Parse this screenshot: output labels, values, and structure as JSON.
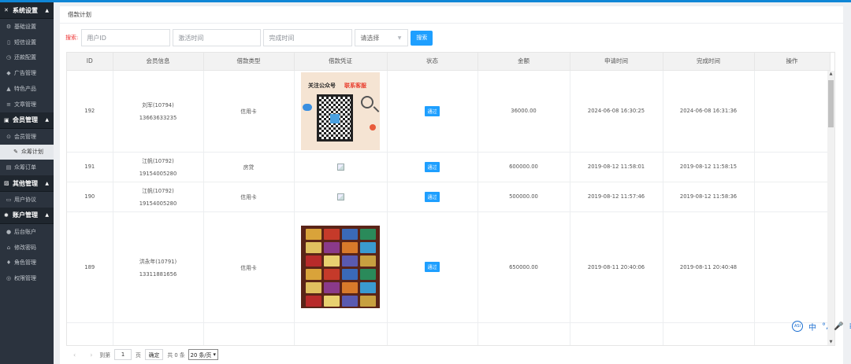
{
  "sidebar": {
    "sections": [
      {
        "title": "系统设置",
        "icon": "tools-icon",
        "glyph": "✕",
        "items": [
          {
            "label": "基础设置",
            "icon": "gear-icon",
            "glyph": "⚙"
          },
          {
            "label": "短信设置",
            "icon": "sms-icon",
            "glyph": "▯"
          },
          {
            "label": "还款配置",
            "icon": "repay-icon",
            "glyph": "◷"
          },
          {
            "label": "广告管理",
            "icon": "ad-icon",
            "glyph": "◆"
          },
          {
            "label": "特色产品",
            "icon": "bell-icon",
            "glyph": "▲"
          },
          {
            "label": "文章管理",
            "icon": "list-icon",
            "glyph": "≡"
          }
        ]
      },
      {
        "title": "会员管理",
        "icon": "member-icon",
        "glyph": "▣",
        "items": [
          {
            "label": "会员管理",
            "icon": "user-icon",
            "glyph": "⊙"
          },
          {
            "label": "众筹计划",
            "icon": "edit-icon",
            "glyph": "✎",
            "active": true
          },
          {
            "label": "众筹订单",
            "icon": "order-icon",
            "glyph": "▤"
          }
        ]
      },
      {
        "title": "其他管理",
        "icon": "other-icon",
        "glyph": "▨",
        "items": [
          {
            "label": "用户协议",
            "icon": "agreement-icon",
            "glyph": "▭"
          }
        ]
      },
      {
        "title": "账户管理",
        "icon": "account-icon",
        "glyph": "✱",
        "items": [
          {
            "label": "后台账户",
            "icon": "admin-icon",
            "glyph": "●"
          },
          {
            "label": "修改密码",
            "icon": "lock-icon",
            "glyph": "⌂"
          },
          {
            "label": "角色管理",
            "icon": "role-icon",
            "glyph": "♦"
          },
          {
            "label": "权限管理",
            "icon": "permission-icon",
            "glyph": "◎"
          }
        ]
      }
    ]
  },
  "page": {
    "title": "借款计划"
  },
  "search": {
    "label": "搜索:",
    "user_id_placeholder": "用户ID",
    "activate_time_placeholder": "激活时间",
    "complete_time_placeholder": "完成时间",
    "select_placeholder": "请选择",
    "button": "搜索"
  },
  "table": {
    "columns": [
      "ID",
      "会员信息",
      "借款类型",
      "借款凭证",
      "状态",
      "金额",
      "申请时间",
      "完成时间",
      "操作"
    ],
    "rows": [
      {
        "id": "192",
        "name": "刘军(10794)",
        "phone": "13663633235",
        "type": "信用卡",
        "voucher": "qr",
        "status": "通过",
        "amount": "36000.00",
        "apply_time": "2024-06-08 16:30:25",
        "done_time": "2024-06-08 16:31:36"
      },
      {
        "id": "191",
        "name": "江帆(10792)",
        "phone": "19154005280",
        "type": "房贷",
        "voucher": "broken",
        "status": "通过",
        "amount": "600000.00",
        "apply_time": "2019-08-12 11:58:01",
        "done_time": "2019-08-12 11:58:15"
      },
      {
        "id": "190",
        "name": "江帆(10792)",
        "phone": "19154005280",
        "type": "信用卡",
        "voucher": "broken",
        "status": "通过",
        "amount": "500000.00",
        "apply_time": "2019-08-12 11:57:46",
        "done_time": "2019-08-12 11:58:36"
      },
      {
        "id": "189",
        "name": "洪永年(10791)",
        "phone": "13311881656",
        "type": "信用卡",
        "voucher": "cards",
        "status": "通过",
        "amount": "650000.00",
        "apply_time": "2019-08-11 20:40:06",
        "done_time": "2019-08-11 20:40:48"
      }
    ],
    "qr_caption_left": "关注公众号",
    "qr_caption_right": "联系客服"
  },
  "pager": {
    "prev": "‹",
    "next": "›",
    "goto_label": "到第",
    "page_value": "1",
    "page_unit": "页",
    "confirm": "确定",
    "total": "共 0 条",
    "page_size": "20 条/页"
  },
  "ime": {
    "lang": "中",
    "items": [
      "°,",
      "🎤",
      "⁞⁞"
    ]
  }
}
